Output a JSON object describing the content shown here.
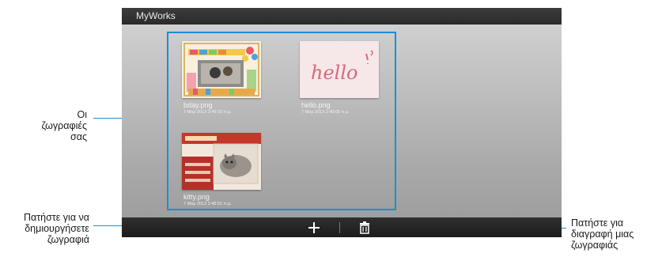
{
  "app": {
    "title": "MyWorks"
  },
  "works": [
    {
      "name": "bday.png",
      "date": "7 Μαρ 2013 2:49:23 π.μ.",
      "thumb": "bday-thumbnail"
    },
    {
      "name": "hello.png",
      "date": "7 Μαρ 2013 2:48:05 π.μ.",
      "thumb": "hello-thumbnail",
      "drawing_text": "hello"
    },
    {
      "name": "kitty.png",
      "date": "7 Μαρ 2013 2:48:51 π.μ.",
      "thumb": "kitty-thumbnail"
    }
  ],
  "toolbar": {
    "add_icon": "plus-icon",
    "delete_icon": "trash-icon"
  },
  "callouts": {
    "works": "Οι ζωγραφιές σας",
    "create": "Πατήστε για να δημιουργήσετε ζωγραφιά",
    "delete": "Πατήστε για διαγραφή μιας ζωγραφιάς"
  },
  "colors": {
    "accent": "#1a8fd6",
    "titlebar": "#2e2e2e"
  }
}
